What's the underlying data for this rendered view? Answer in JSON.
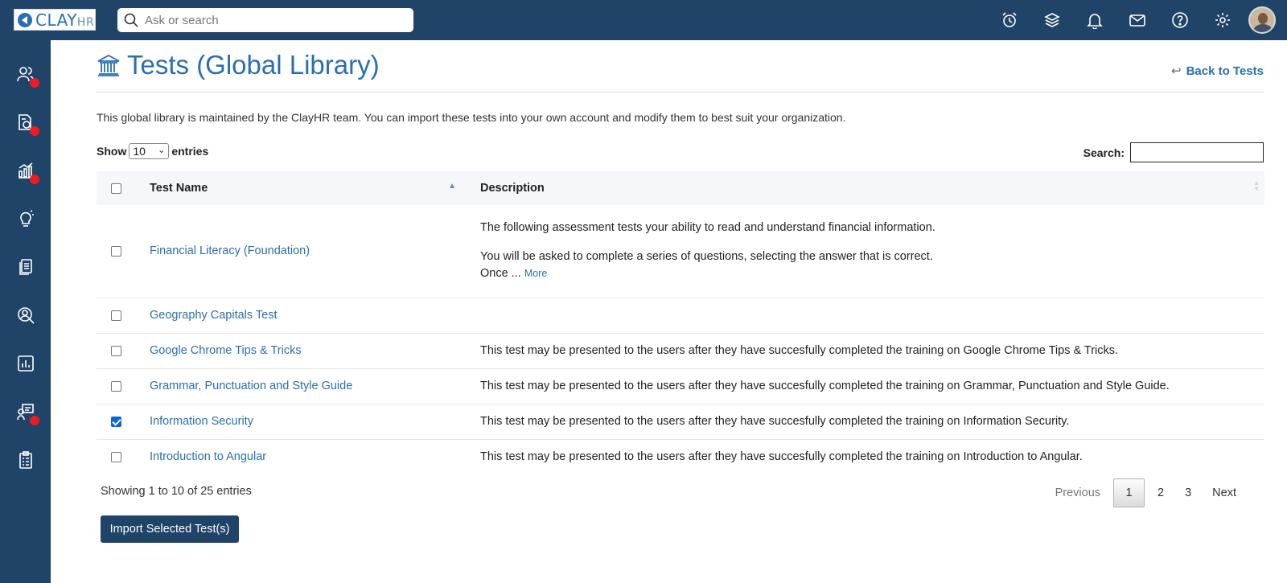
{
  "app": {
    "logo_text": "CLAY",
    "logo_suffix": "HR"
  },
  "topbar": {
    "search_placeholder": "Ask or search",
    "icons": [
      "alarm-clock-icon",
      "layers-icon",
      "bell-icon",
      "mail-icon",
      "help-icon",
      "settings-icon"
    ]
  },
  "sidebar": {
    "items": [
      {
        "icon": "people-icon",
        "badge": true
      },
      {
        "icon": "payroll-doc-icon",
        "badge": true
      },
      {
        "icon": "growth-chart-icon",
        "badge": true
      },
      {
        "icon": "lightbulb-icon",
        "badge": false
      },
      {
        "icon": "documents-icon",
        "badge": false
      },
      {
        "icon": "recruit-search-icon",
        "badge": false
      },
      {
        "icon": "reports-chart-icon",
        "badge": false
      },
      {
        "icon": "training-board-icon",
        "badge": true
      },
      {
        "icon": "clipboard-icon",
        "badge": false
      }
    ]
  },
  "page": {
    "title": "Tests (Global Library)",
    "back_label": "Back to Tests",
    "intro": "This global library is maintained by the ClayHR team. You can import these tests into your own account and modify them to best suit your organization."
  },
  "controls": {
    "show_label": "Show",
    "entries_label": "entries",
    "page_length": "10",
    "search_label": "Search:",
    "search_value": ""
  },
  "table": {
    "columns": [
      "Test Name",
      "Description"
    ],
    "rows": [
      {
        "name": "Financial Literacy (Foundation)",
        "checked": false,
        "desc_line1": "The following assessment tests your ability to read and understand financial information.",
        "desc_line2": "You will be asked to complete a series of questions, selecting the answer that is correct.",
        "desc_line3": "Once ...",
        "more_label": "More"
      },
      {
        "name": "Geography Capitals Test",
        "checked": false,
        "desc": ""
      },
      {
        "name": "Google Chrome Tips & Tricks",
        "checked": false,
        "desc": "This test may be presented to the users after they have succesfully completed the training on Google Chrome Tips & Tricks."
      },
      {
        "name": "Grammar, Punctuation and Style Guide",
        "checked": false,
        "desc": "This test may be presented to the users after they have succesfully completed the training on Grammar, Punctuation and Style Guide."
      },
      {
        "name": "Information Security",
        "checked": true,
        "desc": "This test may be presented to the users after they have succesfully completed the training on Information Security."
      },
      {
        "name": "Introduction to Angular",
        "checked": false,
        "desc": "This test may be presented to the users after they have succesfully completed the training on Introduction to Angular."
      }
    ]
  },
  "footer": {
    "info": "Showing 1 to 10 of 25 entries",
    "previous": "Previous",
    "pages": [
      "1",
      "2",
      "3"
    ],
    "current_page": "1",
    "next": "Next",
    "import_label": "Import Selected Test(s)"
  },
  "colors": {
    "navy": "#1f4468",
    "link": "#2a6fb0",
    "badge": "#ee1b24"
  }
}
